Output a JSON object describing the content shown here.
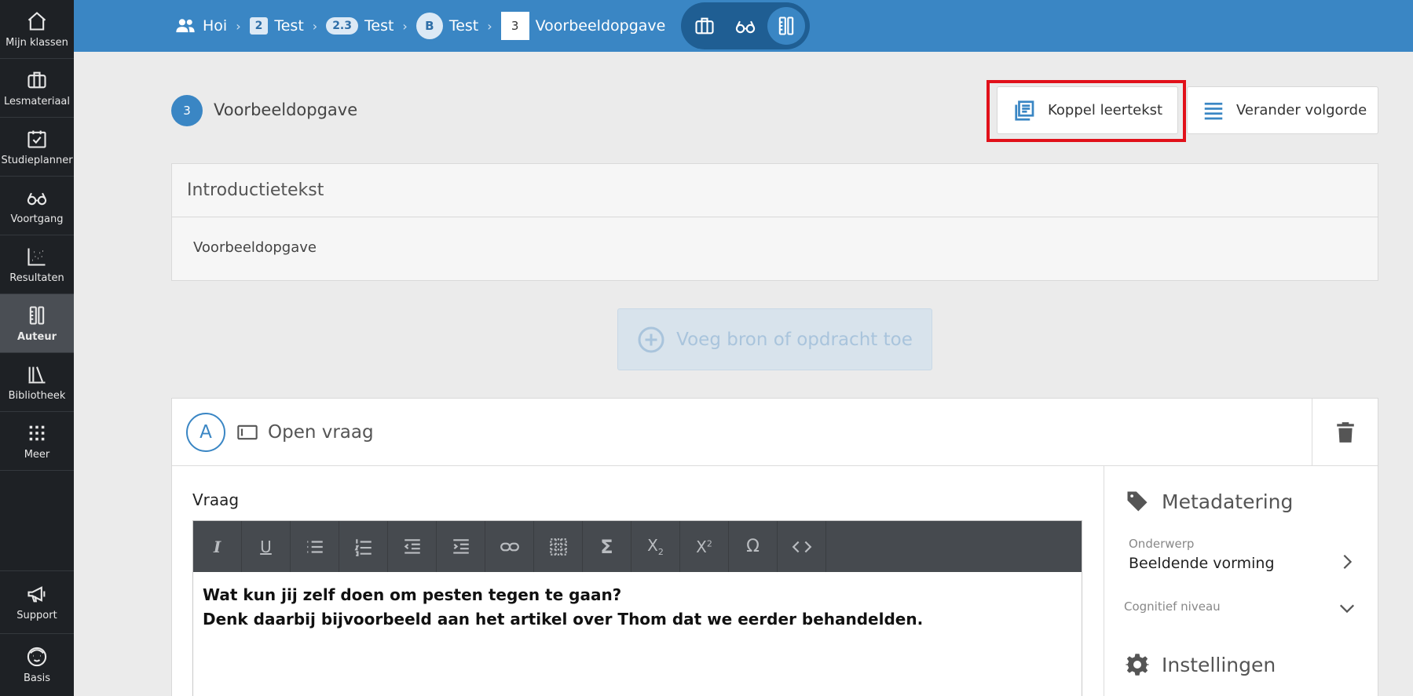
{
  "sidebar": {
    "items": [
      {
        "label": "Mijn klassen",
        "icon": "home-icon"
      },
      {
        "label": "Lesmateriaal",
        "icon": "briefcase-icon"
      },
      {
        "label": "Studieplanner",
        "icon": "calendar-check-icon"
      },
      {
        "label": "Voortgang",
        "icon": "glasses-icon"
      },
      {
        "label": "Resultaten",
        "icon": "scatter-chart-icon"
      },
      {
        "label": "Auteur",
        "icon": "author-tools-icon"
      },
      {
        "label": "Bibliotheek",
        "icon": "library-icon"
      },
      {
        "label": "Meer",
        "icon": "grid-icon"
      }
    ],
    "bottom": [
      {
        "label": "Support",
        "icon": "megaphone-icon"
      },
      {
        "label": "Basis",
        "icon": "avatar-icon"
      }
    ],
    "active": "Auteur"
  },
  "breadcrumb": {
    "home": "Hoi",
    "level1_badge": "2",
    "level1_label": "Test",
    "level2_badge": "2.3",
    "level2_label": "Test",
    "level3_badge": "B",
    "level3_label": "Test",
    "level4_badge": "3",
    "level4_label": "Voorbeeldopgave"
  },
  "header": {
    "number": "3",
    "title": "Voorbeeldopgave",
    "koppel_label": "Koppel leertekst",
    "volgorde_label": "Verander volgorde"
  },
  "intro": {
    "heading": "Introductietekst",
    "body": "Voorbeeldopgave"
  },
  "add_button": {
    "label": "Voeg bron of opdracht toe"
  },
  "question": {
    "letter": "A",
    "type": "Open vraag",
    "field_label": "Vraag",
    "text_line1": "Wat kun jij zelf doen om pesten tegen te gaan?",
    "text_line2": "Denk daarbij bijvoorbeeld aan het artikel over Thom dat we eerder behandelden."
  },
  "metadata": {
    "title": "Metadatering",
    "onderwerp_label": "Onderwerp",
    "onderwerp_value": "Beeldende vorming",
    "cognitief_label": "Cognitief niveau",
    "settings_title": "Instellingen"
  },
  "colors": {
    "accent": "#3a86c4",
    "sidebar": "#1e2125",
    "highlight": "#e1111a"
  }
}
